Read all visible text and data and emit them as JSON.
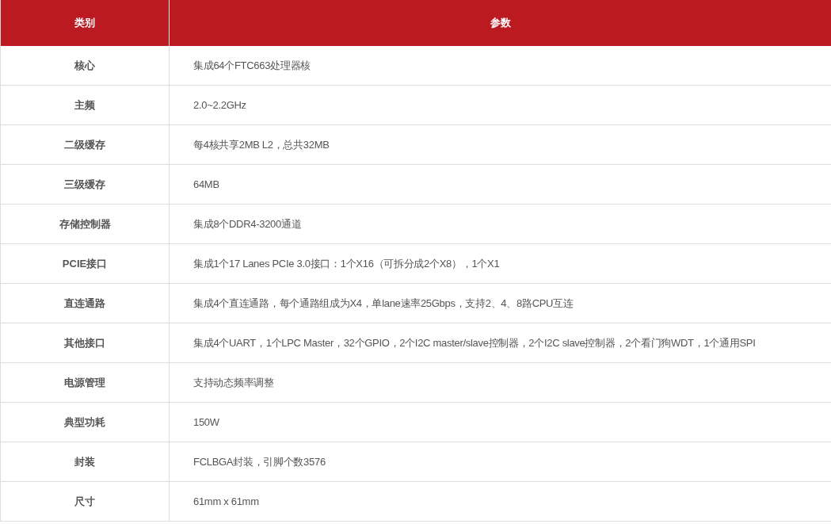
{
  "table": {
    "columns": [
      "类别",
      "参数"
    ],
    "rows": [
      [
        "核心",
        "集成64个FTC663处理器核"
      ],
      [
        "主频",
        "2.0~2.2GHz"
      ],
      [
        "二级缓存",
        "每4核共享2MB L2，总共32MB"
      ],
      [
        "三级缓存",
        "64MB"
      ],
      [
        "存储控制器",
        "集成8个DDR4-3200通道"
      ],
      [
        "PCIE接口",
        "集成1个17 Lanes PCIe 3.0接口：1个X16（可拆分成2个X8），1个X1"
      ],
      [
        "直连通路",
        "集成4个直连通路，每个通路组成为X4，单lane速率25Gbps，支持2、4、8路CPU互连"
      ],
      [
        "其他接口",
        "集成4个UART，1个LPC Master，32个GPIO，2个I2C master/slave控制器，2个I2C slave控制器，2个看门狗WDT，1个通用SPI"
      ],
      [
        "电源管理",
        "支持动态频率调整"
      ],
      [
        "典型功耗",
        "150W"
      ],
      [
        "封装",
        "FCLBGA封装，引脚个数3576"
      ],
      [
        "尺寸",
        "61mm x 61mm"
      ]
    ]
  }
}
